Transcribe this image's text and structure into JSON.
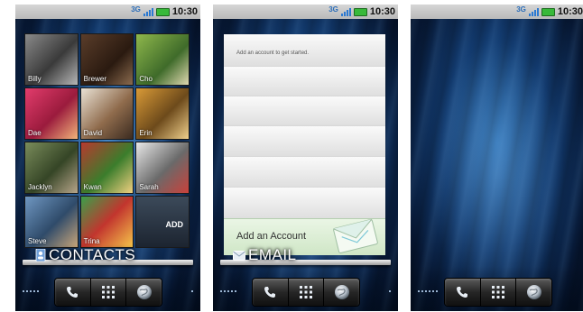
{
  "statusbar": {
    "network": "3G",
    "time": "10:30"
  },
  "contacts": {
    "title": "CONTACTS",
    "names": [
      "Billy",
      "Brewer",
      "Cho",
      "Dae",
      "David",
      "Erin",
      "Jacklyn",
      "Kwan",
      "Sarah",
      "Steve",
      "Trina"
    ],
    "add_label": "ADD"
  },
  "email": {
    "title": "EMAIL",
    "prompt": "Add an account to get started.",
    "add_account": "Add an Account"
  },
  "dock": {
    "buttons": [
      "phone-icon",
      "apps-grid-icon",
      "browser-globe-icon"
    ]
  },
  "colors": {
    "accent": "#2b79d2",
    "battery": "#38b93a",
    "status_bg": "#c8c8c8"
  }
}
